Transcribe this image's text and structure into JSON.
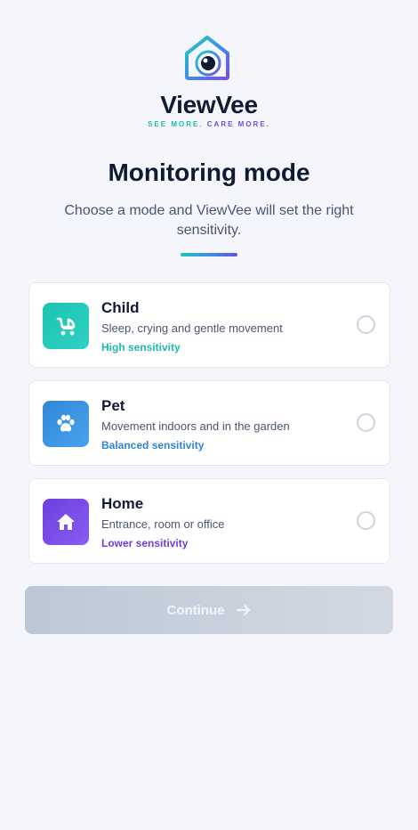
{
  "brand": {
    "name": "ViewVee",
    "tagline_part1": "SEE MORE.",
    "tagline_part2": "CARE MORE."
  },
  "header": {
    "title": "Monitoring mode",
    "subtitle": "Choose a mode and ViewVee will set the right sensitivity."
  },
  "modes": [
    {
      "name": "Child",
      "description": "Sleep, crying and gentle movement",
      "sensitivity": "High sensitivity",
      "icon": "stroller-icon",
      "color": "#1fb8ad",
      "selected": false
    },
    {
      "name": "Pet",
      "description": "Movement indoors and in the garden",
      "sensitivity": "Balanced sensitivity",
      "icon": "paw-icon",
      "color": "#2f86d8",
      "selected": false
    },
    {
      "name": "Home",
      "description": "Entrance, room or office",
      "sensitivity": "Lower sensitivity",
      "icon": "house-icon",
      "color": "#6a3fdc",
      "selected": false
    }
  ],
  "actions": {
    "continue_label": "Continue",
    "continue_icon": "arrow-right-icon",
    "continue_enabled": false
  },
  "colors": {
    "background": "#f4f6fb",
    "text_primary": "#0f1a33",
    "accent_teal": "#1fb8ad",
    "accent_blue": "#2f86d8",
    "accent_purple": "#6a3fdc"
  }
}
